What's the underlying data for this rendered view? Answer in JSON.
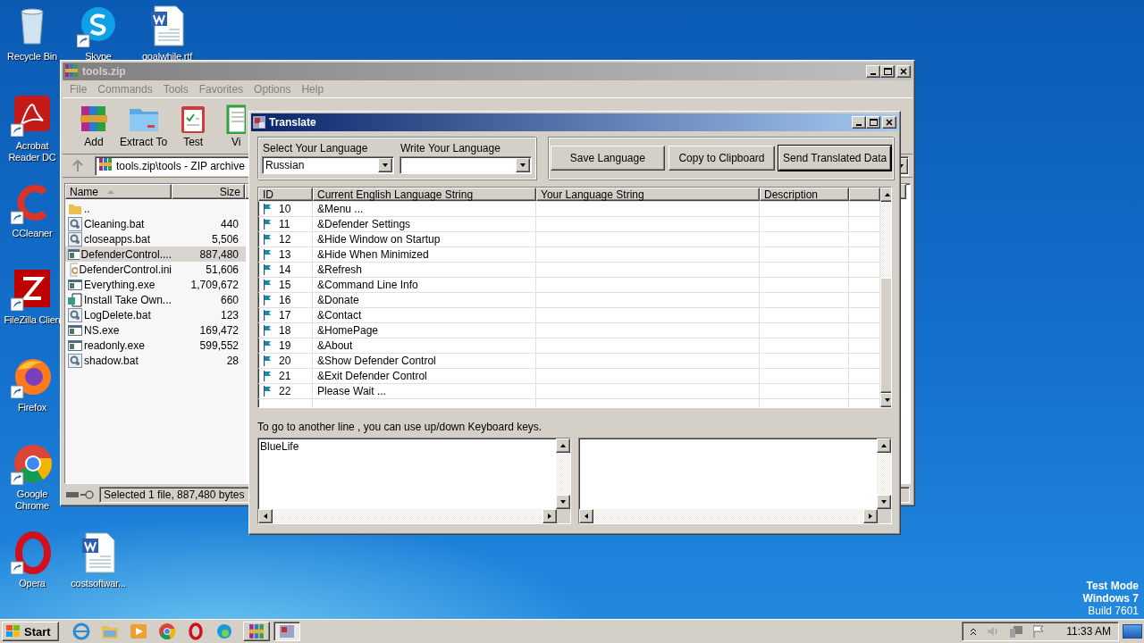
{
  "desktop_icons": [
    {
      "label": "Recycle Bin"
    },
    {
      "label": "Skype"
    },
    {
      "label": "goalwhile.rtf"
    },
    {
      "label": "Acrobat Reader DC"
    },
    {
      "label": "CCleaner"
    },
    {
      "label": "FileZilla Clien"
    },
    {
      "label": "Firefox"
    },
    {
      "label": "Google Chrome"
    },
    {
      "label": "Opera"
    },
    {
      "label": "costsoftwar..."
    }
  ],
  "winrar": {
    "title": "tools.zip",
    "menu": [
      "File",
      "Commands",
      "Tools",
      "Favorites",
      "Options",
      "Help"
    ],
    "toolbar": [
      {
        "label": "Add"
      },
      {
        "label": "Extract To"
      },
      {
        "label": "Test"
      },
      {
        "label": "Vi"
      }
    ],
    "address": "tools.zip\\tools - ZIP archive",
    "columns": [
      {
        "label": "Name",
        "sorted": true
      },
      {
        "label": "Size",
        "sorted": false
      }
    ],
    "files": [
      {
        "kind": "folder",
        "name": "..",
        "selected": false
      },
      {
        "kind": "bat",
        "name": "Cleaning.bat",
        "size": "440",
        "selected": false
      },
      {
        "kind": "bat",
        "name": "closeapps.bat",
        "size": "5,506",
        "selected": false
      },
      {
        "kind": "exe",
        "name": "DefenderControl....",
        "size": "887,480",
        "selected": true
      },
      {
        "kind": "ini",
        "name": "DefenderControl.ini",
        "size": "51,606",
        "selected": false
      },
      {
        "kind": "exe",
        "name": "Everything.exe",
        "size": "1,709,672",
        "selected": false
      },
      {
        "kind": "reg",
        "name": "Install Take Own...",
        "size": "660",
        "selected": false
      },
      {
        "kind": "bat",
        "name": "LogDelete.bat",
        "size": "123",
        "selected": false
      },
      {
        "kind": "exe",
        "name": "NS.exe",
        "size": "169,472",
        "selected": false
      },
      {
        "kind": "exe",
        "name": "readonly.exe",
        "size": "599,552",
        "selected": false
      },
      {
        "kind": "bat",
        "name": "shadow.bat",
        "size": "28",
        "selected": false
      }
    ],
    "status": "Selected 1 file, 887,480 bytes"
  },
  "translate": {
    "title": "Translate",
    "select_label": "Select Your Language",
    "select_value": "Russian",
    "write_label": "Write Your Language",
    "buttons": [
      {
        "label": "Save Language",
        "default": false
      },
      {
        "label": "Copy to Clipboard",
        "default": false
      },
      {
        "label": "Send Translated Data",
        "default": true
      }
    ],
    "columns": [
      "ID",
      "Current English Language String",
      "Your Language String",
      "Description"
    ],
    "rows": [
      {
        "id": "10",
        "text": "&Menu ..."
      },
      {
        "id": "11",
        "text": "&Defender Settings"
      },
      {
        "id": "12",
        "text": "&Hide Window on Startup"
      },
      {
        "id": "13",
        "text": "&Hide When Minimized"
      },
      {
        "id": "14",
        "text": "&Refresh"
      },
      {
        "id": "15",
        "text": "&Command Line Info"
      },
      {
        "id": "16",
        "text": "&Donate"
      },
      {
        "id": "17",
        "text": "&Contact"
      },
      {
        "id": "18",
        "text": "&HomePage"
      },
      {
        "id": "19",
        "text": "&About"
      },
      {
        "id": "20",
        "text": "&Show Defender Control"
      },
      {
        "id": "21",
        "text": "&Exit Defender Control"
      },
      {
        "id": "22",
        "text": "Please Wait ..."
      }
    ],
    "hint": "To go to another line , you can use up/down Keyboard keys.",
    "source_text": "BlueLife"
  },
  "edition": [
    "Test Mode",
    "Windows 7",
    "Build 7601"
  ],
  "taskbar": {
    "start": "Start",
    "tasks": [
      {
        "selected": false
      },
      {
        "selected": true
      }
    ],
    "time": "11:33 AM"
  }
}
